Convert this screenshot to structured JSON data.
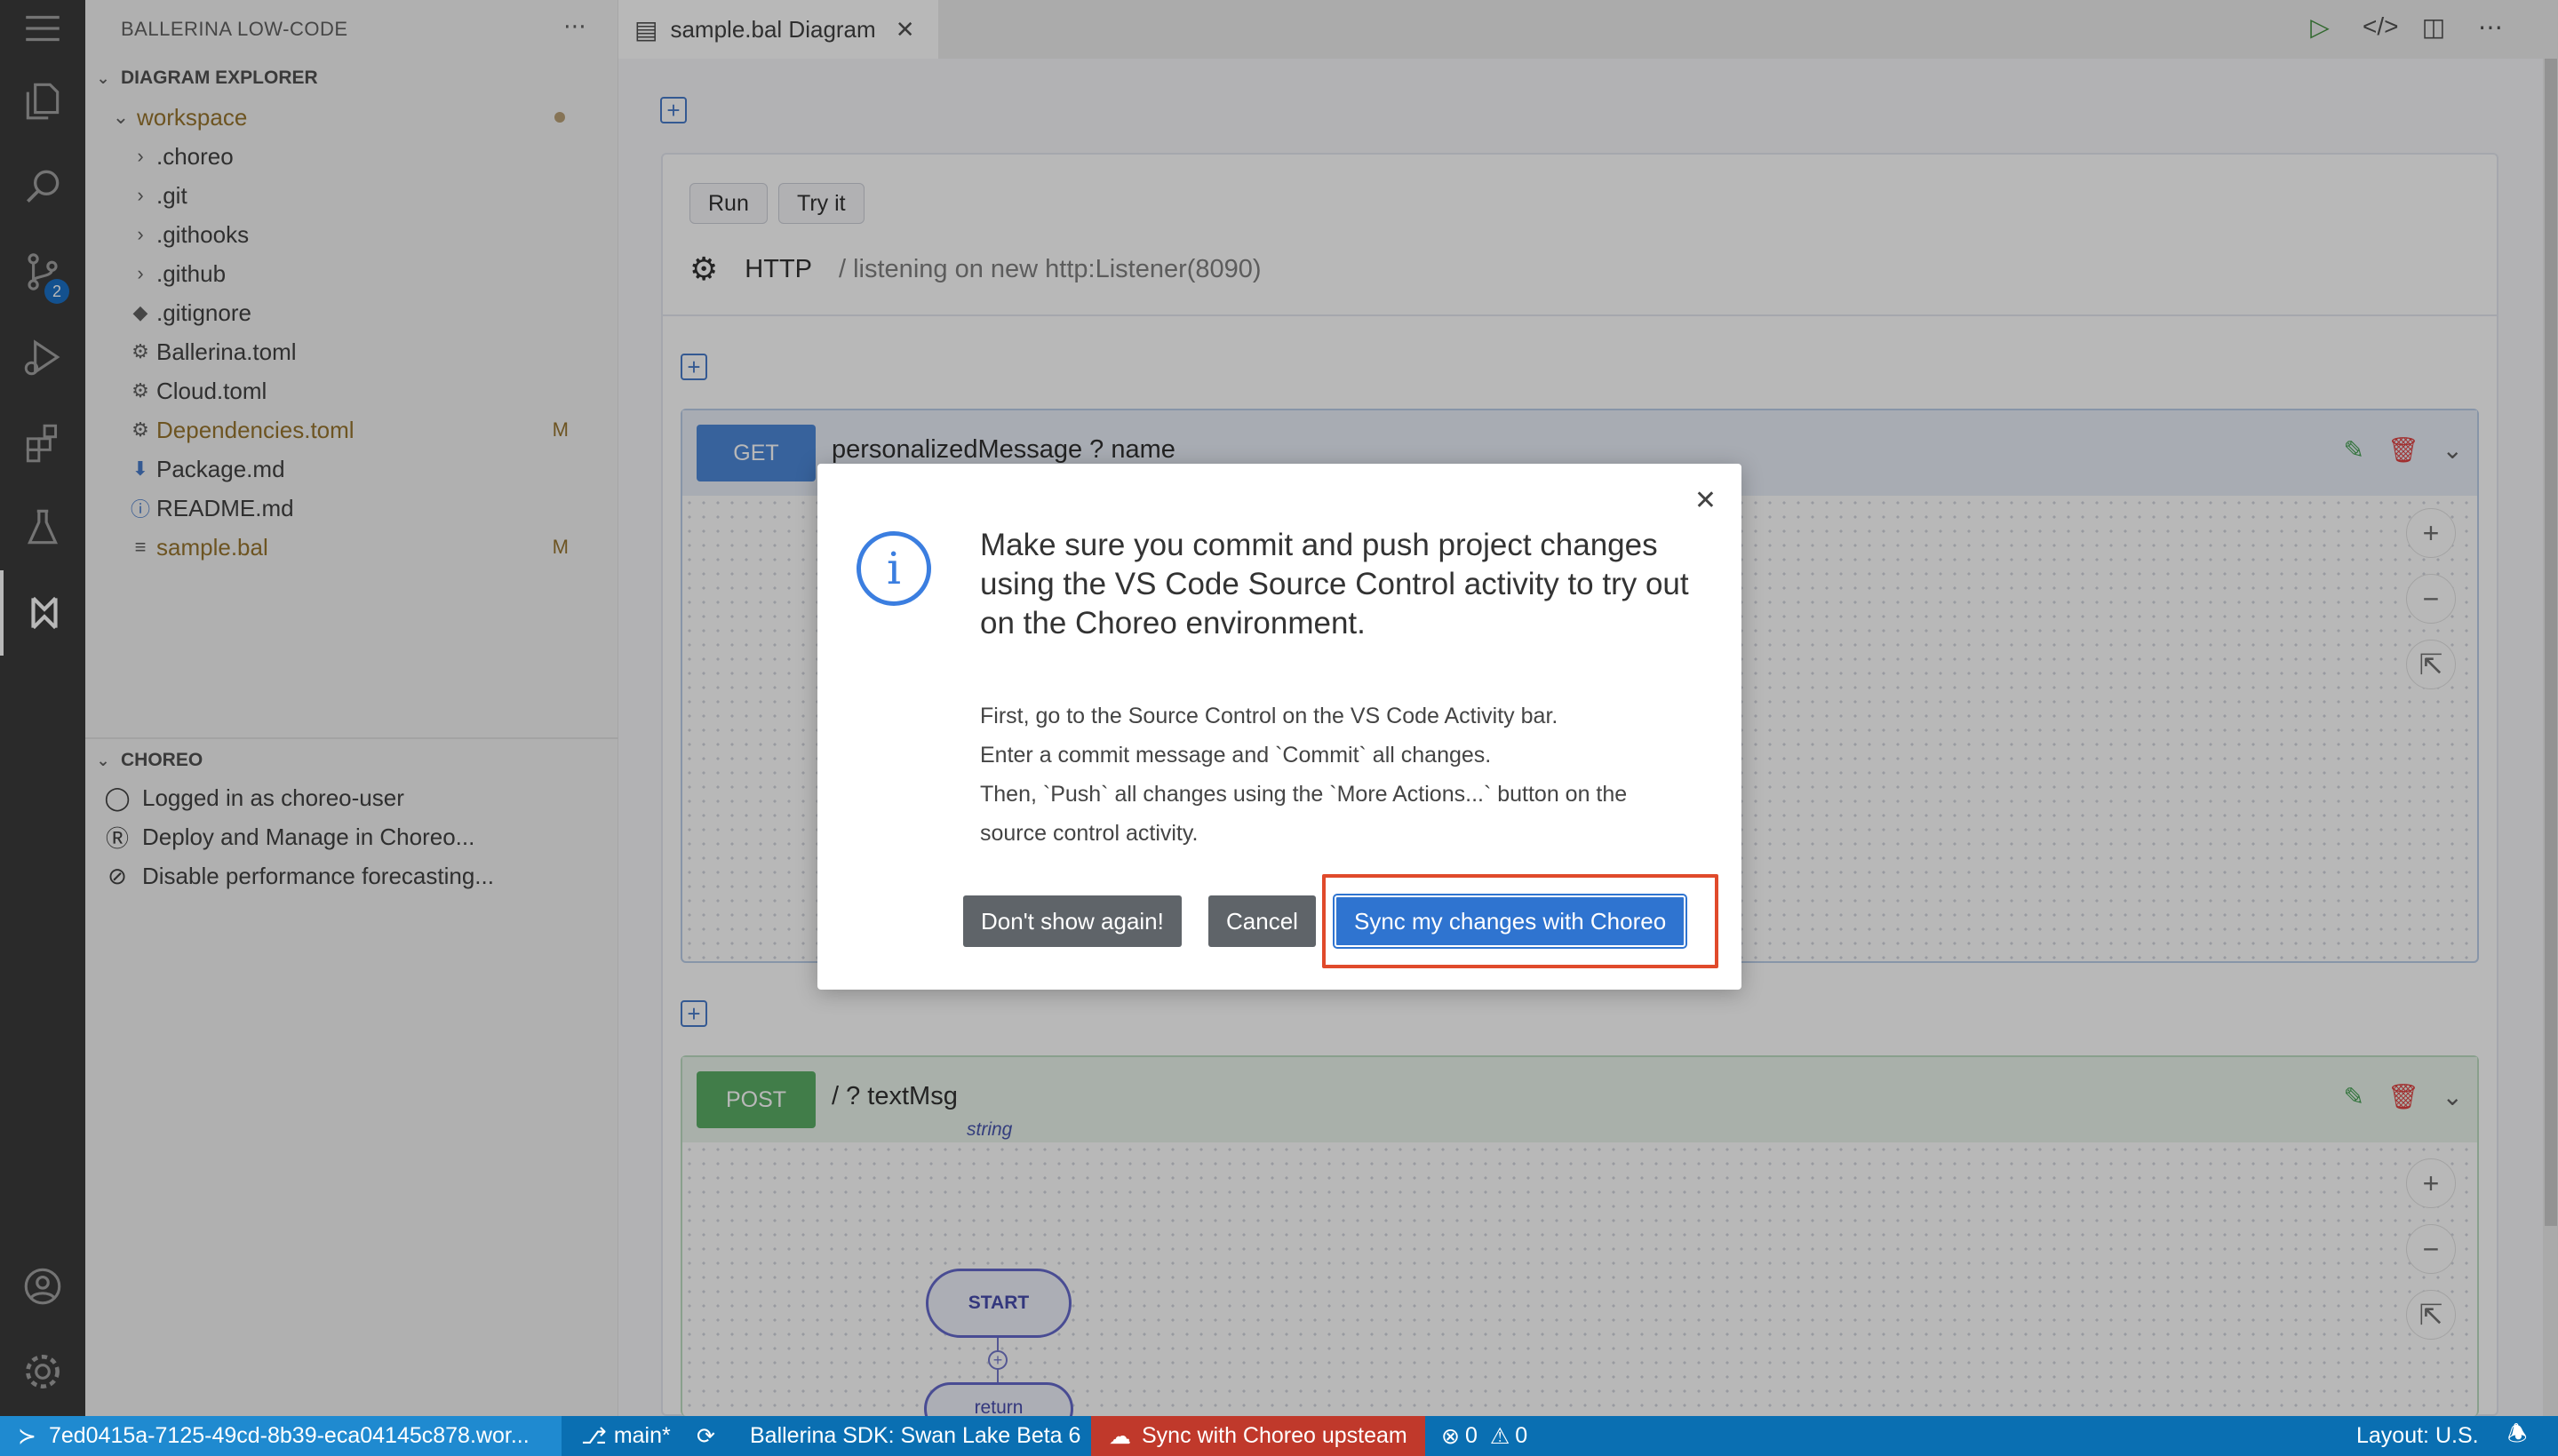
{
  "colors": {
    "accent": "#2f74d0",
    "get": "#3f7fd6",
    "post": "#4ea75a",
    "statusbar": "#0a6fb2",
    "highlight": "#e04a2b"
  },
  "activity_bar": {
    "items": [
      "menu-icon",
      "files-icon",
      "search-icon",
      "source-control-icon",
      "run-debug-icon",
      "extensions-icon",
      "testing-icon",
      "choreo-icon",
      "account-icon",
      "settings-icon"
    ],
    "source_control_badge": "2"
  },
  "sidebar": {
    "title": "BALLERINA LOW-CODE",
    "more": "⋯",
    "explorer_title": "DIAGRAM EXPLORER",
    "workspace": "workspace",
    "files": [
      {
        "name": ".choreo",
        "kind": "folder",
        "badge": ""
      },
      {
        "name": ".git",
        "kind": "folder",
        "badge": ""
      },
      {
        "name": ".githooks",
        "kind": "folder",
        "badge": ""
      },
      {
        "name": ".github",
        "kind": "folder",
        "badge": ""
      },
      {
        "name": ".gitignore",
        "kind": "file",
        "badge": ""
      },
      {
        "name": "Ballerina.toml",
        "kind": "file",
        "badge": ""
      },
      {
        "name": "Cloud.toml",
        "kind": "file",
        "badge": ""
      },
      {
        "name": "Dependencies.toml",
        "kind": "file",
        "badge": "M"
      },
      {
        "name": "Package.md",
        "kind": "file",
        "badge": ""
      },
      {
        "name": "README.md",
        "kind": "file",
        "badge": ""
      },
      {
        "name": "sample.bal",
        "kind": "file",
        "badge": "M"
      }
    ],
    "choreo_title": "CHOREO",
    "choreo_items": [
      "Logged in as choreo-user",
      "Deploy and Manage in Choreo...",
      "Disable performance forecasting..."
    ]
  },
  "editor": {
    "tab_label": "sample.bal Diagram",
    "service": {
      "run_label": "Run",
      "try_label": "Try it",
      "type": "HTTP",
      "listener": "/ listening on new http:Listener(8090)"
    },
    "resources": [
      {
        "method": "GET",
        "path": "personalizedMessage ? name",
        "param_type": ""
      },
      {
        "method": "POST",
        "path": "/ ? textMsg",
        "param_type": "string"
      }
    ],
    "start_label": "START",
    "return_label": "return"
  },
  "dialog": {
    "title": "Make sure you commit and push project changes using the VS Code Source Control activity to try out on the Choreo environment.",
    "body_lines": [
      "First, go to the Source Control on the VS Code Activity bar.",
      "Enter a commit message and `Commit` all changes.",
      "Then, `Push` all changes using the `More Actions...` button on the",
      "source control activity."
    ],
    "dont_show": "Don't show again!",
    "cancel": "Cancel",
    "sync": "Sync my changes with Choreo"
  },
  "status_bar": {
    "remote": "7ed0415a-7125-49cd-8b39-eca04145c878.wor...",
    "branch": "main*",
    "sdk": "Ballerina SDK: Swan Lake Beta 6",
    "sync": "Sync with Choreo upsteam",
    "errors": "0",
    "warnings": "0",
    "layout": "Layout: U.S."
  }
}
